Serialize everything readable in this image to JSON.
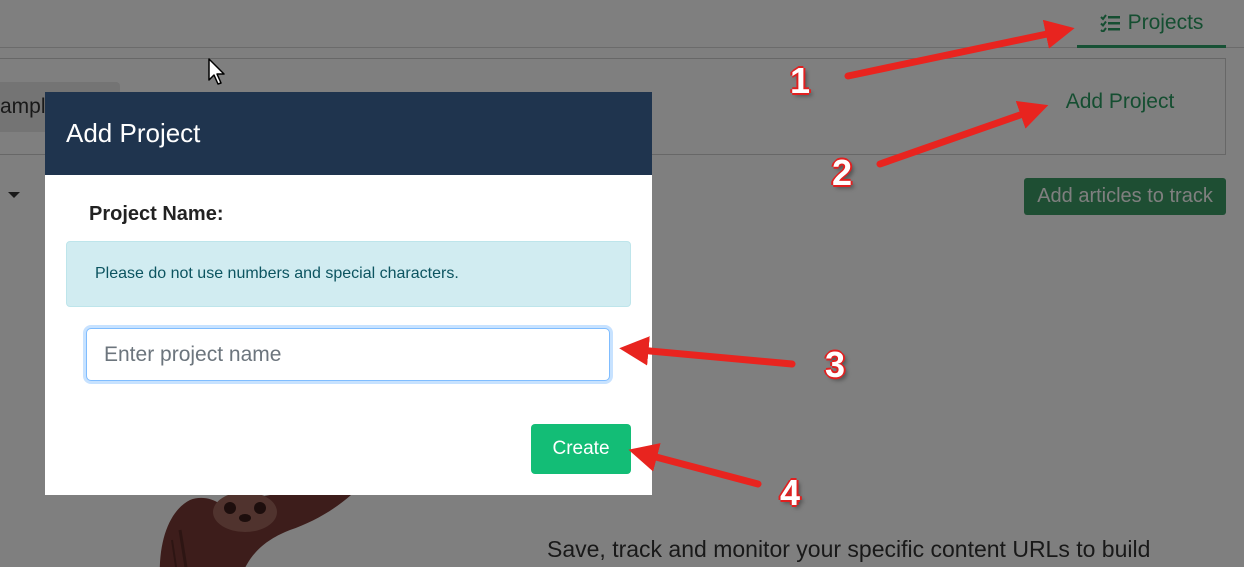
{
  "nav": {
    "projects_tab_label": "Projects"
  },
  "background": {
    "example_chip_text": "ample",
    "add_project_link": "Add Project",
    "track_button_label": "Add articles to track",
    "promo_text": "Save, track and monitor your specific content URLs to build"
  },
  "modal": {
    "title": "Add Project",
    "field_label": "Project Name:",
    "alert_text": "Please do not use numbers and special characters.",
    "input_placeholder": "Enter project name",
    "input_value": "",
    "create_button_label": "Create"
  },
  "annotations": {
    "labels": [
      "1",
      "2",
      "3",
      "4"
    ],
    "arrow_color": "#e8241f"
  },
  "colors": {
    "accent_green": "#2a9d62",
    "modal_header": "#1f344e",
    "create_button": "#13bd76",
    "alert_bg": "#d1ecf1"
  }
}
